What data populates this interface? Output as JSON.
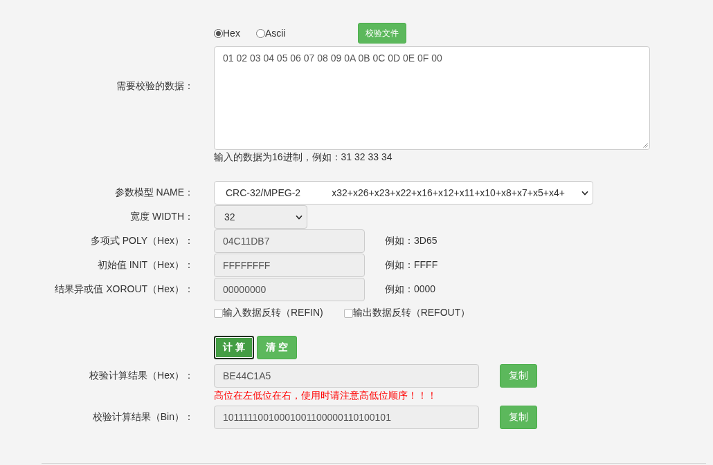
{
  "input_mode": {
    "options": [
      {
        "label": "Hex",
        "selected": true
      },
      {
        "label": "Ascii",
        "selected": false
      }
    ],
    "file_button": "校验文件"
  },
  "data_field": {
    "label": "需要校验的数据：",
    "value": "01 02 03 04 05 06 07 08 09 0A 0B 0C 0D 0E 0F 00",
    "hint": "输入的数据为16进制，例如：31 32 33 34"
  },
  "model_select": {
    "label": "参数模型 NAME：",
    "value": "CRC-32/MPEG-2",
    "polynomial": "x32+x26+x23+x22+x16+x12+x11+x10+x8+x7+x5+x4+",
    "disabled": false
  },
  "width_select": {
    "label": "宽度 WIDTH：",
    "value": "32",
    "disabled": true
  },
  "params": [
    {
      "label": "多项式 POLY（Hex）：",
      "value": "04C11DB7",
      "example": "例如：3D65",
      "disabled": true
    },
    {
      "label": "初始值 INIT（Hex）：",
      "value": "FFFFFFFF",
      "example": "例如：FFFF",
      "disabled": true
    },
    {
      "label": "结果异或值 XOROUT（Hex）：",
      "value": "00000000",
      "example": "例如：0000",
      "disabled": true
    }
  ],
  "reflect_options": [
    {
      "label": "输入数据反转（REFIN)",
      "checked": false
    },
    {
      "label": "输出数据反转（REFOUT）",
      "checked": false
    }
  ],
  "actions": [
    {
      "label": "计算",
      "focused": true
    },
    {
      "label": "清空",
      "focused": false
    }
  ],
  "results": [
    {
      "label": "校验计算结果（Hex）：",
      "value": "BE44C1A5",
      "copy_button": "复制",
      "note": "高位在左低位在右，使用时请注意高低位顺序！！！",
      "disabled": true
    },
    {
      "label": "校验计算结果（Bin）：",
      "value": "10111110010001001100000110100101",
      "copy_button": "复制",
      "disabled": true
    }
  ]
}
